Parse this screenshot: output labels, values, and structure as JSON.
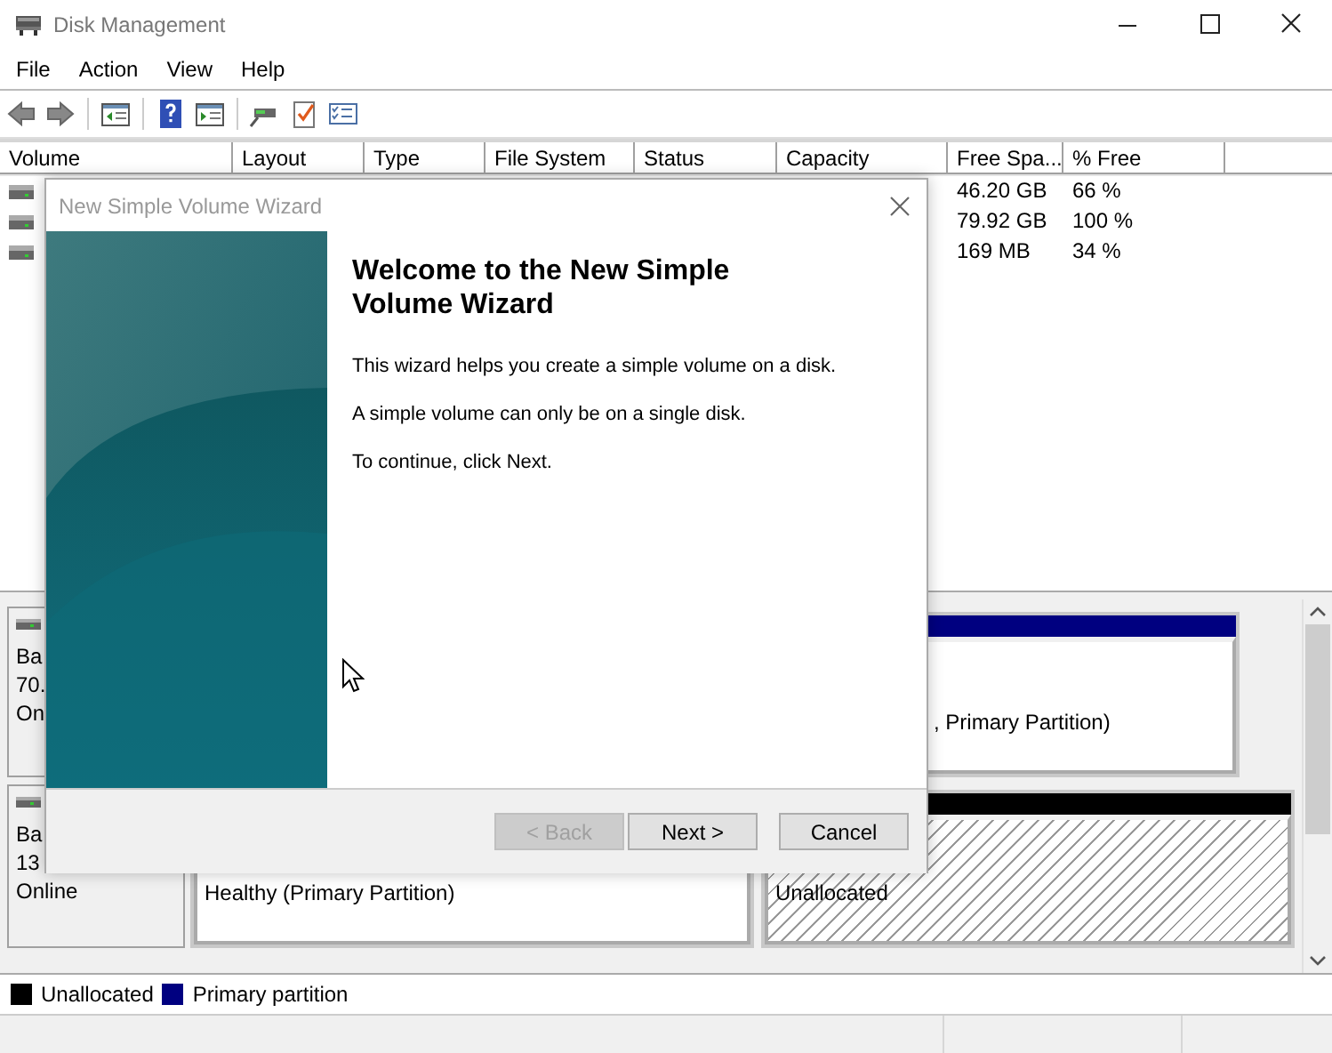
{
  "window": {
    "title": "Disk Management"
  },
  "menu": [
    "File",
    "Action",
    "View",
    "Help"
  ],
  "table": {
    "columns": [
      "Volume",
      "Layout",
      "Type",
      "File System",
      "Status",
      "Capacity",
      "Free Spa...",
      "% Free"
    ],
    "rows": [
      {
        "free": "46.20 GB",
        "percent": "66 %"
      },
      {
        "free": "79.92 GB",
        "percent": "100 %"
      },
      {
        "free": "169 MB",
        "percent": "34 %"
      }
    ]
  },
  "disks": [
    {
      "label": [
        "Ba",
        "70.",
        "On"
      ],
      "partitions": [
        {
          "kind": "primary",
          "header": true,
          "text": ", Primary Partition)"
        }
      ]
    },
    {
      "label": [
        "Ba",
        "13",
        "Online"
      ],
      "partitions": [
        {
          "kind": "primary",
          "text": "Healthy (Primary Partition)"
        },
        {
          "kind": "unallocated",
          "header": true,
          "text": "Unallocated"
        }
      ]
    }
  ],
  "legend": [
    {
      "label": "Unallocated",
      "color": "#000000"
    },
    {
      "label": "Primary partition",
      "color": "#000080"
    }
  ],
  "dialog": {
    "title": "New Simple Volume Wizard",
    "heading": "Welcome to the New Simple Volume Wizard",
    "paragraphs": [
      "This wizard helps you create a simple volume on a disk.",
      "A simple volume can only be on a single disk.",
      "To continue, click Next."
    ],
    "buttons": [
      {
        "label": "< Back",
        "disabled": true
      },
      {
        "label": "Next >",
        "disabled": false
      },
      {
        "label": "Cancel",
        "disabled": false
      }
    ]
  }
}
